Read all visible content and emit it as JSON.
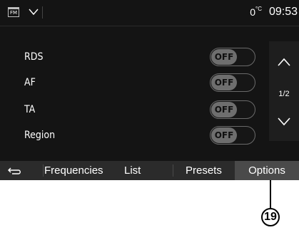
{
  "status_bar": {
    "source_icon_label": "FM",
    "temperature": "0",
    "temperature_unit": "°C",
    "clock": "09:53"
  },
  "options": [
    {
      "label": "RDS",
      "state": "OFF"
    },
    {
      "label": "AF",
      "state": "OFF"
    },
    {
      "label": "TA",
      "state": "OFF"
    },
    {
      "label": "Region",
      "state": "OFF"
    }
  ],
  "pagination": {
    "indicator": "1/2"
  },
  "tabs": {
    "frequencies": "Frequencies",
    "list": "List",
    "presets": "Presets",
    "options": "Options",
    "active": "options"
  },
  "callout": {
    "number": "19"
  },
  "icons": {
    "back": "back-arrow-icon",
    "source_menu": "chevron-down-icon",
    "scroll_up": "chevron-up-icon",
    "scroll_down": "chevron-down-icon"
  },
  "colors": {
    "screen_background": "#141414",
    "tab_bar": "#2b2b2b",
    "active_tab": "#4a4a4a",
    "toggle_off": "#6e6e6e"
  }
}
